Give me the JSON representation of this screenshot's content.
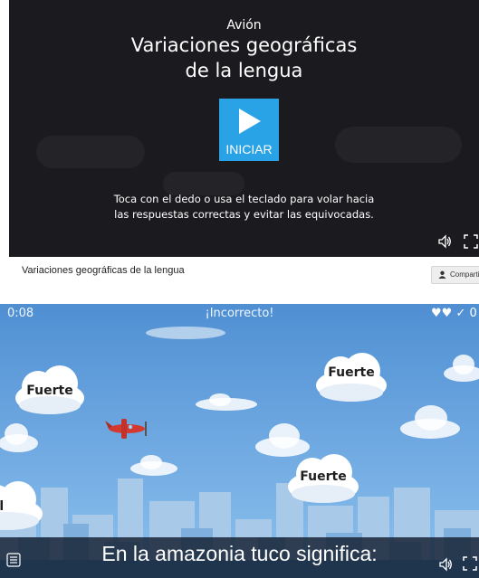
{
  "start": {
    "subtitle": "Avión",
    "title_line1": "Variaciones geográficas",
    "title_line2": "de la lengua",
    "start_label": "INICIAR",
    "instructions_line1": "Toca con el dedo o usa el teclado para volar hacia",
    "instructions_line2": "las respuestas correctas y evitar las equivocadas."
  },
  "caption": {
    "activity_name": "Variaciones geográficas de la lengua",
    "share_label": "Compartir"
  },
  "game": {
    "timer": "0:08",
    "feedback": "¡Incorrecto!",
    "hearts": "♥♥ ✓ 0",
    "question": "En la amazonia tuco significa:",
    "answers": [
      "Fuerte",
      "Fuerte",
      "Fuerte",
      "ébil"
    ]
  },
  "colors": {
    "start_bg": "#1b1b1f",
    "start_button": "#2aa3e6",
    "sky_top": "#4f8fd2",
    "sky_bottom": "#8cc2ee",
    "plane": "#d33a2f"
  },
  "icons": [
    "play-icon",
    "volume-icon",
    "fullscreen-icon",
    "share-user-icon",
    "menu-icon",
    "heart-icon",
    "check-icon"
  ]
}
